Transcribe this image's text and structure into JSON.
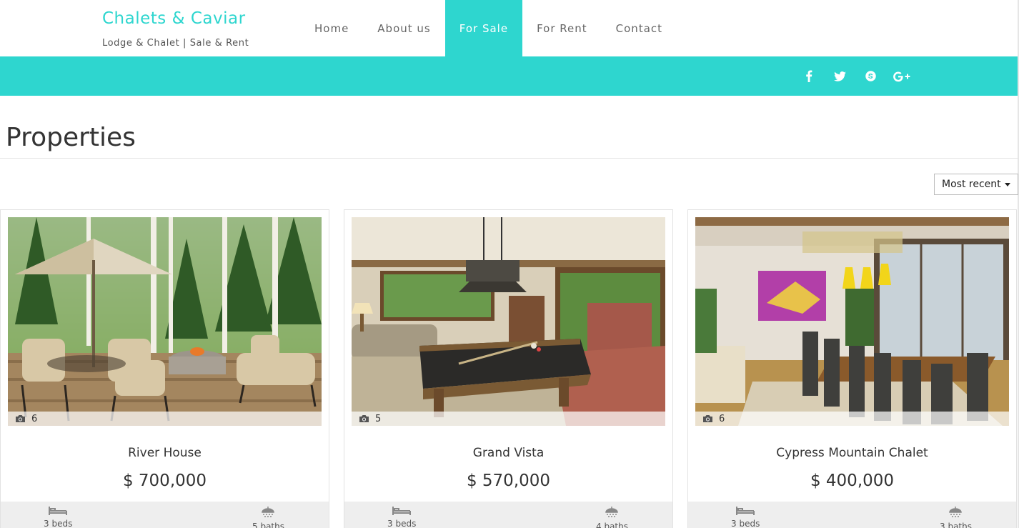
{
  "brand": {
    "title": "Chalets & Caviar",
    "subtitle": "Lodge & Chalet | Sale & Rent",
    "accent_color": "#2ed6cf"
  },
  "nav": [
    {
      "label": "Home",
      "active": false
    },
    {
      "label": "About us",
      "active": false
    },
    {
      "label": "For Sale",
      "active": true
    },
    {
      "label": "For Rent",
      "active": false
    },
    {
      "label": "Contact",
      "active": false
    }
  ],
  "social": [
    "facebook-icon",
    "twitter-icon",
    "skype-icon",
    "google-plus-icon"
  ],
  "page": {
    "title": "Properties",
    "sort_label": "Most recent"
  },
  "properties": [
    {
      "name": "River House",
      "price": "$ 700,000",
      "photos": "6",
      "beds": "3 beds",
      "baths": "5 baths"
    },
    {
      "name": "Grand Vista",
      "price": "$ 570,000",
      "photos": "5",
      "beds": "3 beds",
      "baths": "4 baths"
    },
    {
      "name": "Cypress Mountain Chalet",
      "price": "$ 400,000",
      "photos": "6",
      "beds": "3 beds",
      "baths": "3 baths"
    }
  ]
}
